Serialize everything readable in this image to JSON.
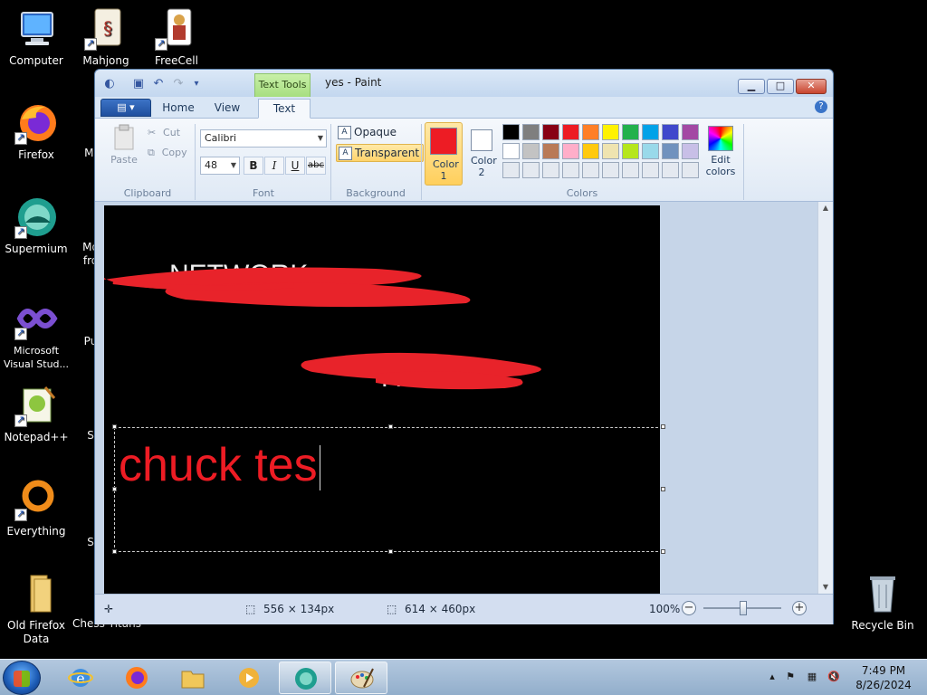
{
  "desktop": {
    "icons": [
      {
        "label": "Computer"
      },
      {
        "label": "Mahjong"
      },
      {
        "label": "FreeCell"
      },
      {
        "label": "Firefox"
      },
      {
        "label": "Supermium"
      },
      {
        "label": "Microsoft Visual Stud..."
      },
      {
        "label": "Notepad++"
      },
      {
        "label": "Everything"
      },
      {
        "label": "Old Firefox Data"
      },
      {
        "label": "Chess Titans"
      },
      {
        "label": "Recycle Bin"
      }
    ],
    "partial_labels": {
      "mi": "Mi",
      "mo": "Mo",
      "fro": "fro",
      "pu": "Pu",
      "s1": "S",
      "s2": "S"
    }
  },
  "window": {
    "title": "yes - Paint",
    "context_tab": "Text Tools",
    "controls": {
      "minimize": "▁",
      "maximize": "□",
      "close": "✕"
    },
    "tabs": [
      "Home",
      "View",
      "Text"
    ],
    "active_tab": "Text",
    "help": "?"
  },
  "ribbon": {
    "clipboard": {
      "paste": "Paste",
      "cut": "Cut",
      "copy": "Copy",
      "label": "Clipboard"
    },
    "font": {
      "family": "Calibri",
      "size": "48",
      "bold": "B",
      "italic": "I",
      "underline": "U",
      "strike": "abc",
      "label": "Font"
    },
    "background": {
      "opaque": "Opaque",
      "transparent": "Transparent",
      "label": "Background",
      "selected": "Transparent"
    },
    "colors": {
      "color1_label": "Color 1",
      "color2_label": "Color 2",
      "color1": "#ed1c24",
      "color2": "#ffffff",
      "edit_label": "Edit colors",
      "label": "Colors",
      "palette_row1": [
        "#000000",
        "#7f7f7f",
        "#880015",
        "#ed1c24",
        "#ff7f27",
        "#fff200",
        "#22b14c",
        "#00a2e8",
        "#3f48cc",
        "#a349a4"
      ],
      "palette_row2": [
        "#ffffff",
        "#c3c3c3",
        "#b97a57",
        "#ffaec9",
        "#ffc90e",
        "#efe4b0",
        "#b5e61d",
        "#99d9ea",
        "#7092be",
        "#c8bfe7"
      ]
    }
  },
  "canvas": {
    "typed_text": "chuck tes",
    "text_color": "#ed1c24"
  },
  "status": {
    "selection_size": "556 × 134px",
    "image_size": "614 × 460px",
    "zoom": "100%"
  },
  "taskbar": {
    "time": "7:49 PM",
    "date": "8/26/2024"
  }
}
